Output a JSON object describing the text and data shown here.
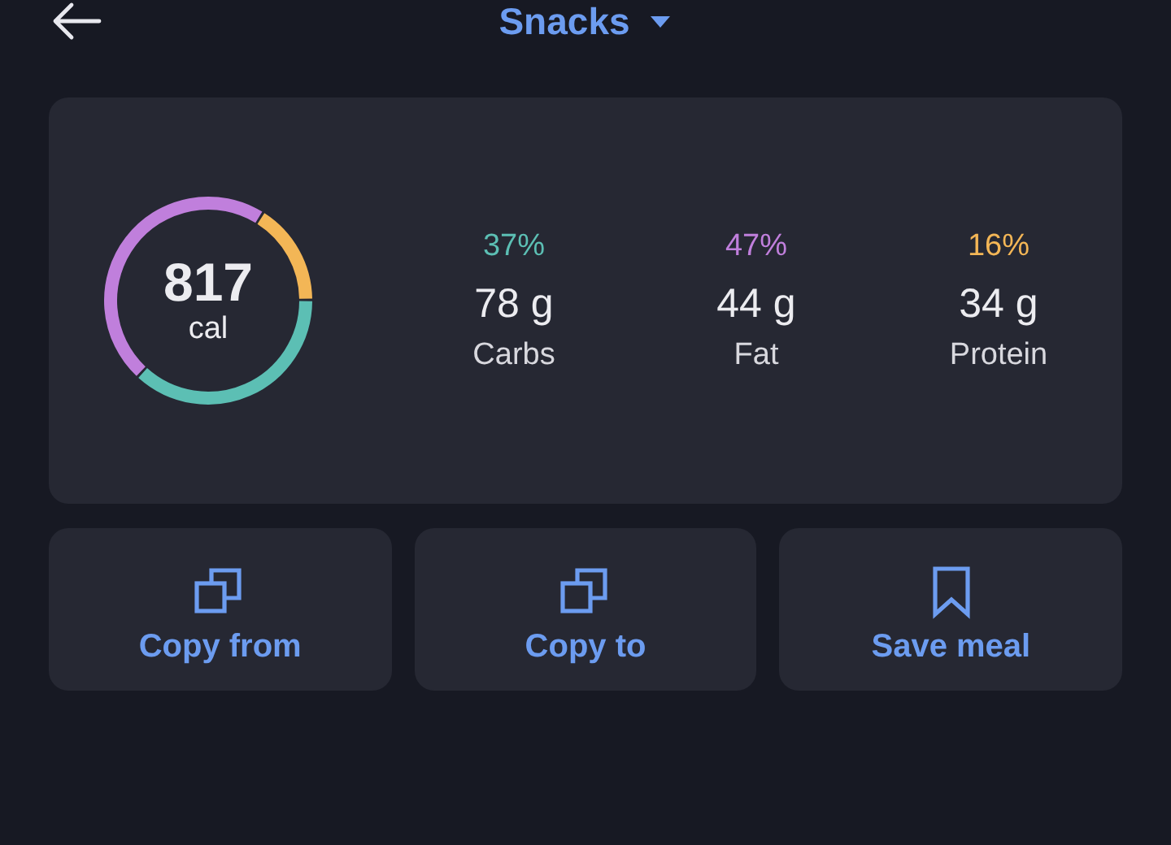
{
  "header": {
    "title": "Snacks"
  },
  "summary": {
    "calories": "817",
    "unit": "cal",
    "macros": [
      {
        "percent": "37%",
        "amount": "78 g",
        "name": "Carbs",
        "color": "#5cbfb4"
      },
      {
        "percent": "47%",
        "amount": "44 g",
        "name": "Fat",
        "color": "#c07fdc"
      },
      {
        "percent": "16%",
        "amount": "34 g",
        "name": "Protein",
        "color": "#f3b656"
      }
    ]
  },
  "actions": [
    {
      "kind": "copy",
      "label": "Copy from"
    },
    {
      "kind": "copy",
      "label": "Copy to"
    },
    {
      "kind": "save",
      "label": "Save meal"
    }
  ]
}
